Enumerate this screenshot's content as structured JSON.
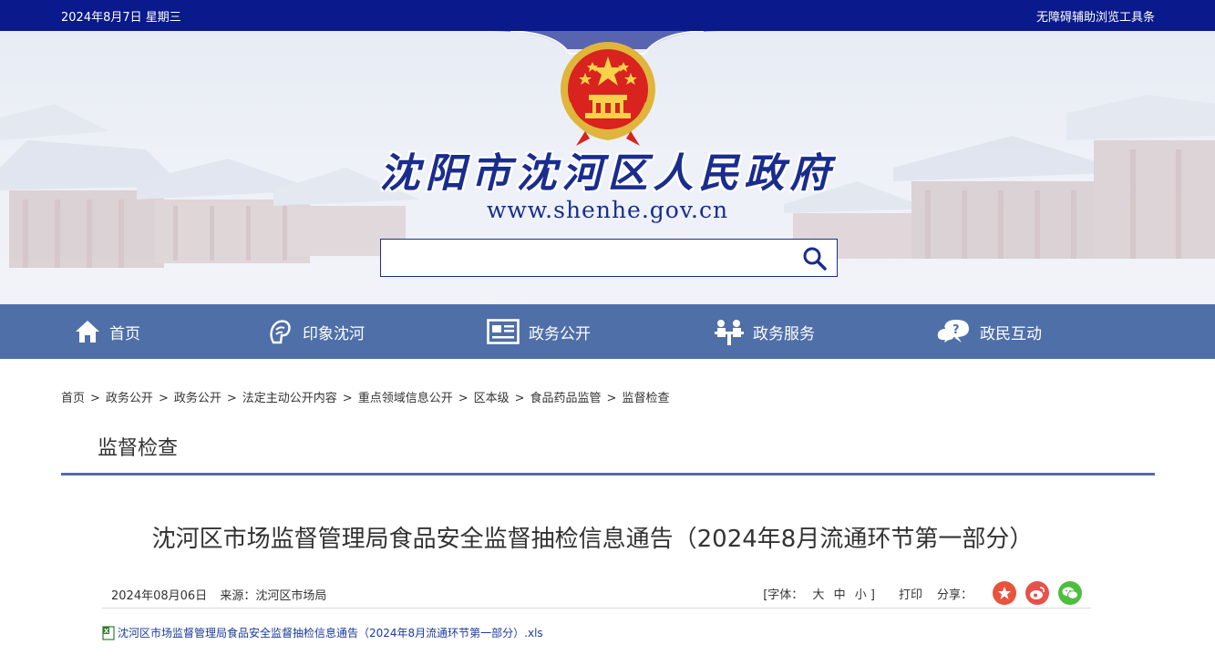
{
  "topbar": {
    "date": "2024年8月7日 星期三",
    "accessibility_link": "无障碍辅助浏览工具条"
  },
  "header": {
    "site_title": "沈阳市沈河区人民政府",
    "site_url": "www.shenhe.gov.cn",
    "emblem_icon": "national-emblem-icon"
  },
  "search": {
    "placeholder": "",
    "button_icon": "search-icon"
  },
  "nav": {
    "items": [
      {
        "label": "首页",
        "icon": "home-icon"
      },
      {
        "label": "印象沈河",
        "icon": "impression-icon"
      },
      {
        "label": "政务公开",
        "icon": "newspaper-icon"
      },
      {
        "label": "政务服务",
        "icon": "service-desk-icon"
      },
      {
        "label": "政民互动",
        "icon": "chat-question-icon"
      }
    ]
  },
  "breadcrumb": {
    "items": [
      "首页",
      "政务公开",
      "政务公开",
      "法定主动公开内容",
      "重点领域信息公开",
      "区本级",
      "食品药品监管",
      "监督检查"
    ],
    "separator": ">"
  },
  "section": {
    "title": "监督检查"
  },
  "article": {
    "title": "沈河区市场监督管理局食品安全监督抽检信息通告（2024年8月流通环节第一部分）",
    "date": "2024年08月06日",
    "source": "来源：沈河区市场局",
    "font_size_label": "[字体：",
    "font_sizes": [
      "大",
      "中",
      "小"
    ],
    "font_size_close": "]",
    "print_label": "打印",
    "share_label": "分享：",
    "share_icons": [
      "party-share-icon",
      "weibo-icon",
      "wechat-icon"
    ],
    "attachment": "沈河区市场监督管理局食品安全监督抽检信息通告（2024年8月流通环节第一部分）.xls"
  },
  "colors": {
    "topbar": "#0a1a8c",
    "nav": "#4f6fa8",
    "title_blue": "#1a2d8e",
    "share_red": "#e8533c",
    "weibo_red": "#e6514a",
    "wechat_green": "#4cbf3c"
  }
}
